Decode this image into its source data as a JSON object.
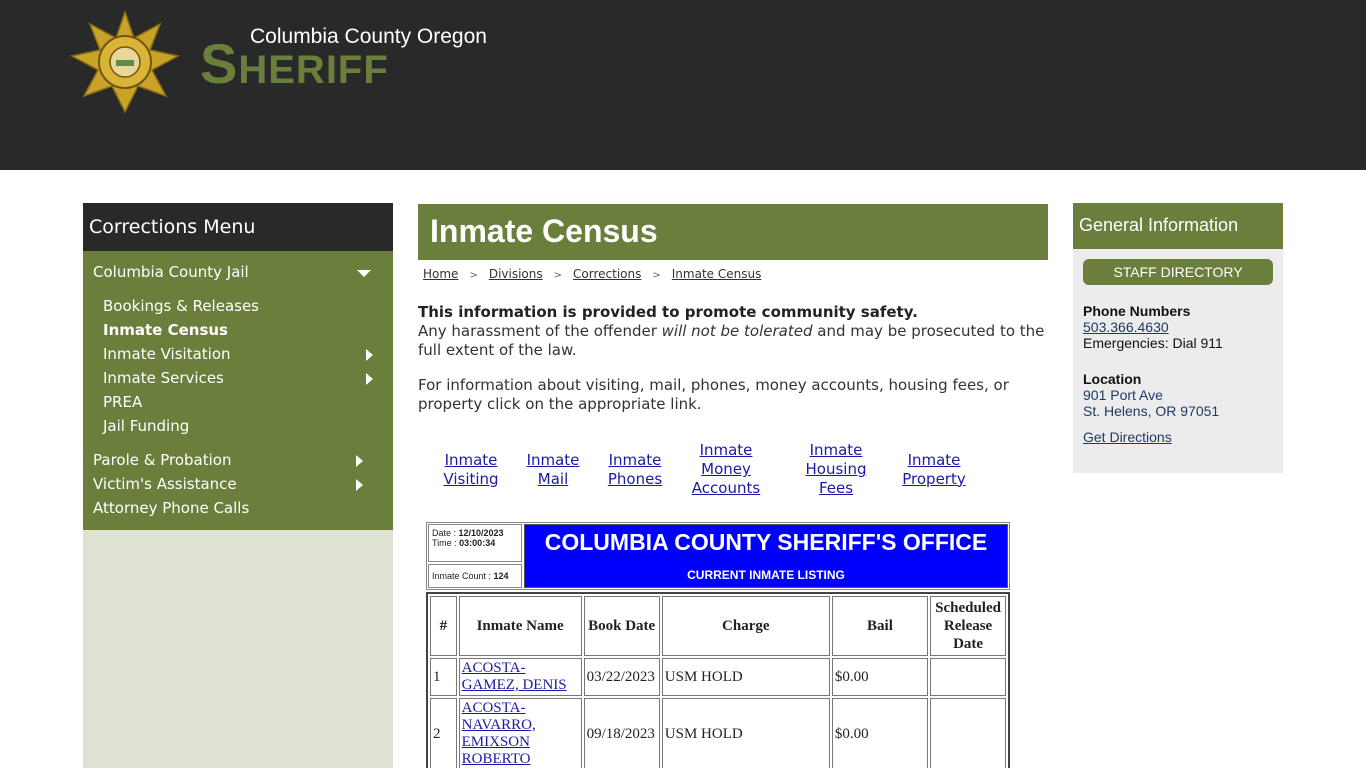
{
  "header": {
    "subtitle": "Columbia County Oregon",
    "title_initial": "S",
    "title_rest": "HERIFF",
    "badge_icon": "sheriff-star-badge"
  },
  "sidebar": {
    "title": "Corrections Menu",
    "items": [
      {
        "label": "Columbia County Jail",
        "level": 0,
        "icon": "chevron-down"
      },
      {
        "label": "Bookings & Releases",
        "level": 1
      },
      {
        "label": "Inmate Census",
        "level": 1,
        "active": true
      },
      {
        "label": "Inmate Visitation",
        "level": 1,
        "icon": "chevron-right"
      },
      {
        "label": "Inmate Services",
        "level": 1,
        "icon": "chevron-right"
      },
      {
        "label": "PREA",
        "level": 1
      },
      {
        "label": "Jail Funding",
        "level": 1
      },
      {
        "label": "Parole & Probation",
        "level": 0,
        "icon": "chevron-right"
      },
      {
        "label": "Victim's Assistance",
        "level": 0,
        "icon": "chevron-right"
      },
      {
        "label": "Attorney Phone Calls",
        "level": 0
      }
    ]
  },
  "main": {
    "title": "Inmate Census",
    "breadcrumb": [
      "Home",
      "Divisions",
      "Corrections",
      "Inmate Census"
    ],
    "intro_bold": "This information is provided to promote community safety.",
    "intro_1a": "Any harassment of the offender ",
    "intro_1b": "will not be tolerated",
    "intro_1c": " and may be prosecuted to the full extent of the law.",
    "intro_2": "For information about visiting, mail, phones, money accounts, housing fees, or property click on the appropriate link.",
    "quick_links": [
      {
        "line1": "Inmate",
        "line2": "Visiting",
        "line3": ""
      },
      {
        "line1": "Inmate",
        "line2": "Mail",
        "line3": ""
      },
      {
        "line1": "Inmate",
        "line2": "Phones",
        "line3": ""
      },
      {
        "line1": "Inmate",
        "line2": "Money",
        "line3": "Accounts"
      },
      {
        "line1": "Inmate",
        "line2": "Housing",
        "line3": "Fees"
      },
      {
        "line1": "Inmate",
        "line2": "Property",
        "line3": ""
      }
    ]
  },
  "census": {
    "date_label": "Date : ",
    "date": "12/10/2023",
    "time_label": "Time : ",
    "time": "03:00:34",
    "count_label": "Inmate Count : ",
    "count": "124",
    "banner_title": "COLUMBIA COUNTY SHERIFF'S OFFICE",
    "banner_subtitle": "CURRENT INMATE LISTING",
    "banner_color": "#0000ff",
    "columns": [
      "#",
      "Inmate Name",
      "Book Date",
      "Charge",
      "Bail",
      "Scheduled Release Date"
    ],
    "rows": [
      {
        "num": "1",
        "name": "ACOSTA-GAMEZ, DENIS",
        "book_date": "03/22/2023",
        "charge": "USM HOLD",
        "bail": "$0.00",
        "release": ""
      },
      {
        "num": "2",
        "name": "ACOSTA-NAVARRO, EMIXSON ROBERTO",
        "book_date": "09/18/2023",
        "charge": "USM HOLD",
        "bail": "$0.00",
        "release": ""
      }
    ]
  },
  "info": {
    "title": "General Information",
    "staff_button": "STAFF DIRECTORY",
    "phone_heading": "Phone Numbers",
    "phone": "503.366.4630",
    "emergency": "Emergencies: Dial 911",
    "location_heading": "Location",
    "address_1": "901 Port Ave",
    "address_2": "St. Helens, OR 97051",
    "directions": "Get Directions"
  },
  "colors": {
    "header_bg": "#292929",
    "accent_green": "#6b7f3d",
    "sidebar_bg": "#dde2d3",
    "info_bg": "#ececec",
    "link_blue": "#1a1aa6"
  }
}
